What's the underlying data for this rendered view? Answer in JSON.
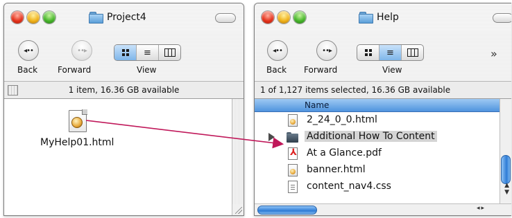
{
  "left_window": {
    "title": "Project4",
    "toolbar": {
      "back_label": "Back",
      "forward_label": "Forward",
      "view_label": "View"
    },
    "status": "1 item, 16.36 GB available",
    "file": {
      "name": "MyHelp01.html",
      "icon": "html-document-icon"
    }
  },
  "right_window": {
    "title": "Help",
    "toolbar": {
      "back_label": "Back",
      "forward_label": "Forward",
      "view_label": "View"
    },
    "status": "1 of 1,127 items selected, 16.36 GB available",
    "column_header": "Name",
    "rows": [
      {
        "name": "2_24_0_0.html",
        "icon": "html-document-icon",
        "selected": false
      },
      {
        "name": "Additional How To Content",
        "icon": "folder-icon",
        "selected": true
      },
      {
        "name": "At a Glance.pdf",
        "icon": "pdf-document-icon",
        "selected": false
      },
      {
        "name": "banner.html",
        "icon": "html-document-icon",
        "selected": false
      },
      {
        "name": "content_nav4.css",
        "icon": "css-document-icon",
        "selected": false
      }
    ]
  },
  "colors": {
    "drag_arrow": "#c0185a",
    "selection_header": "#4f93de"
  }
}
